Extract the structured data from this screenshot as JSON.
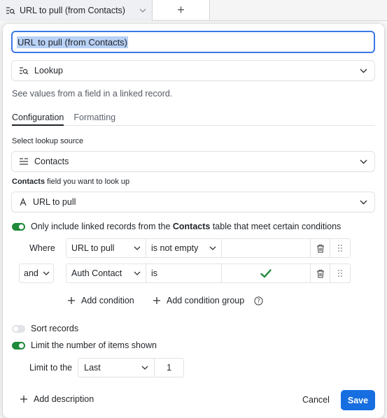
{
  "column_header": {
    "title": "URL to pull (from Contacts)",
    "add_column_symbol": "+"
  },
  "field_name": "URL to pull (from Contacts)",
  "field_type": {
    "label": "Lookup",
    "icon": "lookup-icon"
  },
  "description": "See values from a field in a linked record.",
  "tabs": [
    "Configuration",
    "Formatting"
  ],
  "lookup_source": {
    "label": "Select lookup source",
    "value": "Contacts",
    "icon": "linked-record-icon"
  },
  "lookup_field": {
    "label_bold": "Contacts",
    "label_rest": " field you want to look up",
    "value": "URL to pull",
    "icon": "text-field-icon"
  },
  "conditions_toggle": {
    "text_before": "Only include linked records from the ",
    "table": "Contacts",
    "text_after": " table that meet certain conditions",
    "on": true
  },
  "conditions": [
    {
      "prefix": "Where",
      "field": "URL to pull",
      "operator": "is not empty",
      "value": ""
    },
    {
      "prefix": "and",
      "field": "Auth Contact",
      "operator": "is",
      "value": "checked"
    }
  ],
  "add_condition": "Add condition",
  "add_condition_group": "Add condition group",
  "sort_records": {
    "label": "Sort records",
    "on": false
  },
  "limit_items": {
    "label": "Limit the number of items shown",
    "on": true
  },
  "limit_to": {
    "label": "Limit to the",
    "option": "Last",
    "count": "1"
  },
  "footer": {
    "add_description": "Add description",
    "cancel": "Cancel",
    "save": "Save"
  },
  "colors": {
    "accent": "#166ee1",
    "toggle_on": "#1f8a3a",
    "check": "#1f8a3a",
    "focus": "#3b78e7"
  }
}
